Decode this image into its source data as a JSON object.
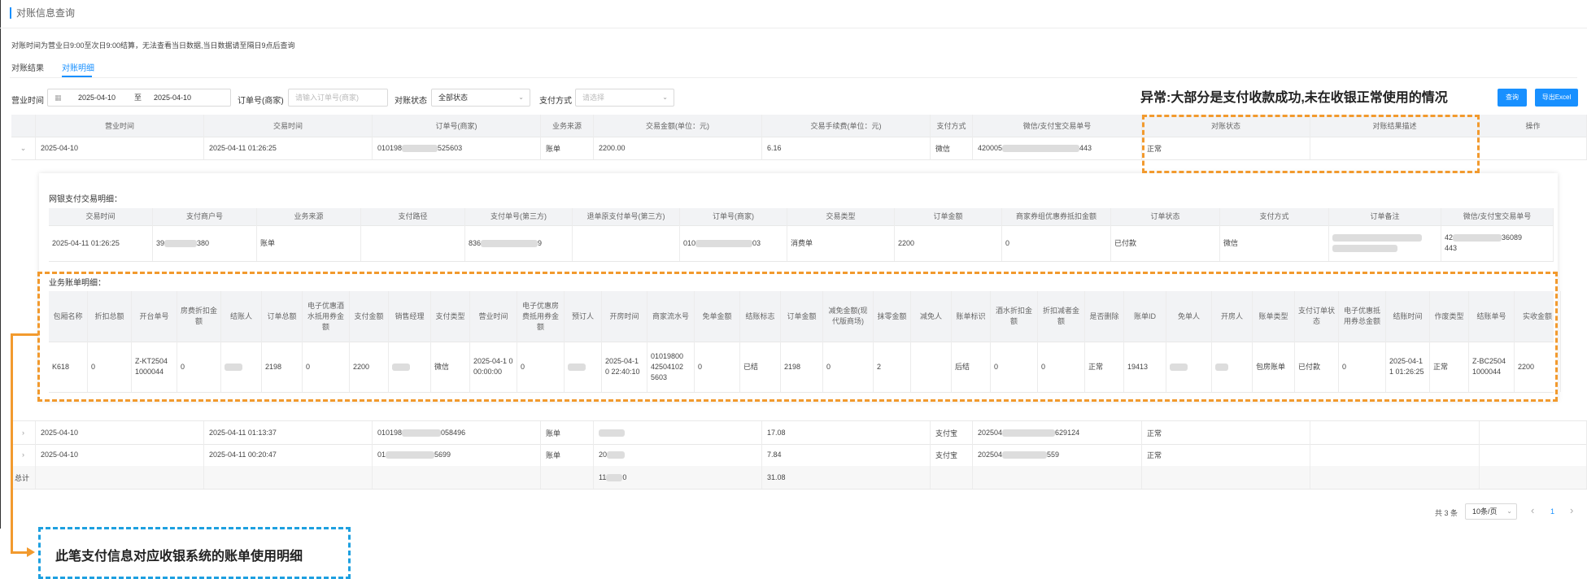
{
  "page": {
    "title": "对账信息查询",
    "notice": "对账时间为营业日9:00至次日9:00结算，无法查看当日数据,当日数据请至隔日9点后查询"
  },
  "tabs": [
    {
      "label": "对账结果",
      "active": false
    },
    {
      "label": "对账明细",
      "active": true
    }
  ],
  "filters": {
    "business_time_label": "营业时间",
    "date_start": "2025-04-10",
    "date_sep": "至",
    "date_end": "2025-04-10",
    "order_no_label": "订单号(商家)",
    "order_no_placeholder": "请输入订单号(商家)",
    "status_label": "对账状态",
    "status_value": "全部状态",
    "pay_method_label": "支付方式",
    "pay_method_placeholder": "请选择",
    "query_button": "查询",
    "export_button": "导出Excel"
  },
  "annotations": {
    "abnormal": "异常:大部分是支付收款成功,未在收银正常使用的情况",
    "bill_detail": "此笔支付信息对应收银系统的账单使用明细"
  },
  "main_table": {
    "headers": [
      "营业时间",
      "交易时间",
      "订单号(商家)",
      "业务来源",
      "交易金额(单位：元)",
      "交易手续费(单位：元)",
      "支付方式",
      "微信/支付宝交易单号",
      "对账状态",
      "对账结果描述",
      "操作"
    ],
    "rows": [
      {
        "toggle": "⌄",
        "business_date": "2025-04-10",
        "trade_time": "2025-04-11 01:26:25",
        "order_prefix": "010198",
        "order_suffix": "525603",
        "source": "账单",
        "amount": "2200.00",
        "fee": "6.16",
        "pay": "微信",
        "txn_prefix": "420005",
        "txn_suffix": "443",
        "status": "正常",
        "desc": ""
      },
      {
        "toggle": "›",
        "business_date": "2025-04-10",
        "trade_time": "2025-04-11 01:13:37",
        "order_prefix": "010198",
        "order_suffix": "058496",
        "source": "账单",
        "amount": "",
        "fee": "17.08",
        "pay": "支付宝",
        "txn_prefix": "202504",
        "txn_suffix": "629124",
        "status": "正常",
        "desc": ""
      },
      {
        "toggle": "›",
        "business_date": "2025-04-10",
        "trade_time": "2025-04-11 00:20:47",
        "order_prefix": "01",
        "order_suffix": "5699",
        "source": "账单",
        "amount": "20",
        "fee": "7.84",
        "pay": "支付宝",
        "txn_prefix": "202504",
        "txn_suffix": "559",
        "status": "正常",
        "desc": ""
      }
    ],
    "total": {
      "label": "总计",
      "amount_prefix": "11",
      "amount_suffix": "0",
      "fee": "31.08"
    }
  },
  "payment_detail": {
    "section_label": "网银支付交易明细：",
    "headers": [
      "交易时间",
      "支付商户号",
      "业务来源",
      "支付路径",
      "支付单号(第三方)",
      "退单原支付单号(第三方)",
      "订单号(商家)",
      "交易类型",
      "订单金额",
      "商家券组优惠券抵扣金额",
      "订单状态",
      "支付方式",
      "订单备注",
      "微信/支付宝交易单号"
    ],
    "row": {
      "trade_time": "2025-04-11 01:26:25",
      "merchant_prefix": "39",
      "merchant_suffix": "380",
      "source": "账单",
      "path": "",
      "pay_no_prefix": "836",
      "pay_no_suffix": "9",
      "refund_no": "",
      "order_prefix": "010",
      "order_suffix": "03",
      "trade_type": "消费单",
      "order_amount": "2200",
      "coupon": "0",
      "order_status": "已付款",
      "pay_method": "微信",
      "remark": "",
      "txn_prefix": "42",
      "txn_mid": "36089",
      "txn_suffix": "443"
    }
  },
  "bill_detail": {
    "section_label": "业务账单明细：",
    "headers": [
      "包厢名称",
      "折扣总额",
      "开台单号",
      "房费折扣金额",
      "结账人",
      "订单总额",
      "电子优惠酒水抵用券金额",
      "支付金额",
      "销售经理",
      "支付类型",
      "营业时间",
      "电子优惠房费抵用券金额",
      "预订人",
      "开房时间",
      "商家流水号",
      "免单金额",
      "结账标志",
      "订单金额",
      "减免金额(现代版商场)",
      "抹零金额",
      "减免人",
      "账单标识",
      "酒水折扣金额",
      "折扣减者金额",
      "是否删除",
      "账单ID",
      "免单人",
      "开房人",
      "账单类型",
      "支付订单状态",
      "电子优惠抵用券总金额",
      "结账时间",
      "作废类型",
      "结账单号",
      "实收金额"
    ],
    "row": [
      "K618",
      "0",
      "Z-KT2504 1000044",
      "0",
      "",
      "2198",
      "0",
      "2200",
      "",
      "微信",
      "2025-04-1 0 00:00:00",
      "0",
      "",
      "2025-04-1 0 22:40:10",
      "01019800 42504102 5603",
      "0",
      "已结",
      "2198",
      "0",
      "2",
      "",
      "后结",
      "0",
      "0",
      "正常",
      "19413",
      "",
      "",
      "包房账单",
      "已付款",
      "0",
      "2025-04-1 1 01:26:25",
      "正常",
      "Z-BC2504 1000044",
      "2200"
    ]
  },
  "pagination": {
    "total": "共 3 条",
    "page_size": "10条/页",
    "prev": "‹",
    "current": "1",
    "next": "›"
  }
}
